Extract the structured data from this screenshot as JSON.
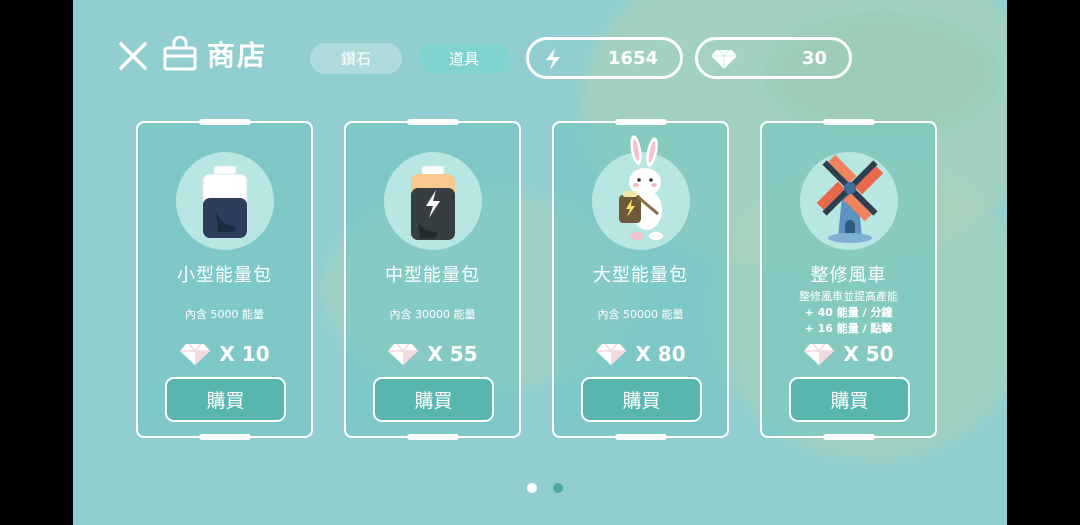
{
  "header": {
    "title": "商店",
    "close_icon": "close-icon",
    "shop_icon": "shopping-bag-icon"
  },
  "tabs": [
    {
      "label": "鑽石",
      "active": false
    },
    {
      "label": "道具",
      "active": true
    }
  ],
  "currency": {
    "energy": {
      "icon": "lightning-icon",
      "value": "1654"
    },
    "gems": {
      "icon": "diamond-icon",
      "value": "30"
    }
  },
  "cards": [
    {
      "name": "小型能量包",
      "desc": "內含 5000 能量",
      "price": "X 10",
      "buy_label": "購買",
      "icon": "small-battery-icon"
    },
    {
      "name": "中型能量包",
      "desc": "內含 30000 能量",
      "price": "X 55",
      "buy_label": "購買",
      "icon": "medium-battery-icon"
    },
    {
      "name": "大型能量包",
      "desc": "內含 50000 能量",
      "price": "X 80",
      "buy_label": "購買",
      "icon": "bunny-battery-icon"
    },
    {
      "name": "整修風車",
      "desc_lines": [
        "整修風車並提高產能",
        "+ 40 能量 / 分鐘",
        "+ 16 能量 / 點擊"
      ],
      "price": "X 50",
      "buy_label": "購買",
      "icon": "windmill-icon"
    }
  ],
  "pagination": {
    "pages": 2,
    "current": 1
  },
  "colors": {
    "accent": "#59b6ae",
    "card_bg": "#6fc4c1",
    "active_tab": "#7fd4cf"
  }
}
